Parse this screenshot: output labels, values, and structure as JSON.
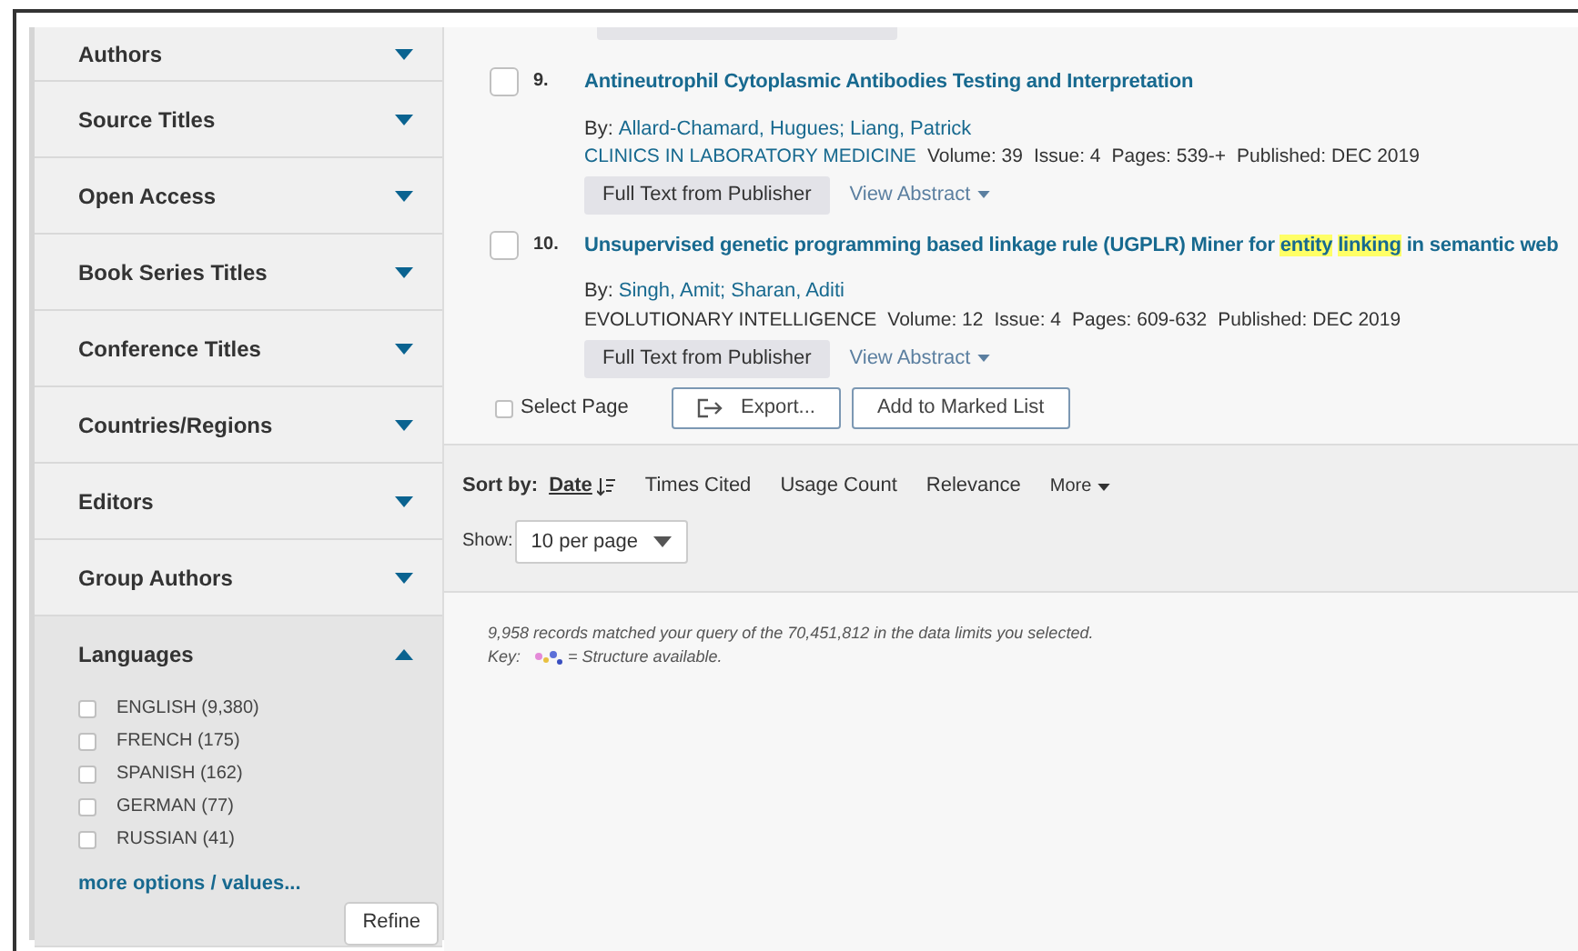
{
  "sidebar": {
    "filters": [
      {
        "label": "Authors",
        "expanded": false
      },
      {
        "label": "Source Titles",
        "expanded": false
      },
      {
        "label": "Open Access",
        "expanded": false
      },
      {
        "label": "Book Series Titles",
        "expanded": false
      },
      {
        "label": "Conference Titles",
        "expanded": false
      },
      {
        "label": "Countries/Regions",
        "expanded": false
      },
      {
        "label": "Editors",
        "expanded": false
      },
      {
        "label": "Group Authors",
        "expanded": false
      },
      {
        "label": "Languages",
        "expanded": true,
        "options": [
          {
            "label": "ENGLISH (9,380)",
            "checked": false
          },
          {
            "label": "FRENCH (175)",
            "checked": false
          },
          {
            "label": "SPANISH (162)",
            "checked": false
          },
          {
            "label": "GERMAN (77)",
            "checked": false
          },
          {
            "label": "RUSSIAN (41)",
            "checked": false
          }
        ],
        "more_link": "more options / values...",
        "refine_button": "Refine"
      }
    ]
  },
  "results": [
    {
      "number": "9.",
      "checked": false,
      "title": [
        {
          "text": "Antineutrophil Cytoplasmic Antibodies Testing and Interpretation",
          "highlighted": false
        }
      ],
      "by_label": "By:",
      "authors": [
        "Allard-Chamard, Hugues;",
        "Liang, Patrick"
      ],
      "source": "CLINICS IN LABORATORY MEDICINE",
      "source_link": true,
      "details": [
        "Volume: 39",
        "Issue: 4",
        "Pages: 539-+",
        "Published: DEC 2019"
      ],
      "full_text_button": "Full Text from Publisher",
      "abstract_link": "View Abstract"
    },
    {
      "number": "10.",
      "checked": false,
      "title": [
        {
          "text": "Unsupervised genetic programming based linkage rule (UGPLR) Miner for",
          "highlighted": false
        },
        {
          "text": "entity",
          "highlighted": true
        },
        {
          "text": "linking",
          "highlighted": true
        },
        {
          "text": "in semantic web",
          "highlighted": false
        }
      ],
      "by_label": "By:",
      "authors": [
        "Singh, Amit;",
        "Sharan, Aditi"
      ],
      "source": "EVOLUTIONARY INTELLIGENCE",
      "source_link": false,
      "details": [
        "Volume: 12",
        "Issue: 4",
        "Pages: 609-632",
        "Published: DEC 2019"
      ],
      "full_text_button": "Full Text from Publisher",
      "abstract_link": "View Abstract"
    }
  ],
  "page_actions": {
    "select_page": {
      "label": "Select Page",
      "checked": false
    },
    "export_button": "Export...",
    "marked_list_button": "Add to Marked List"
  },
  "sort": {
    "label": "Sort by:",
    "options": [
      {
        "label": "Date",
        "selected": true
      },
      {
        "label": "Times Cited",
        "selected": false
      },
      {
        "label": "Usage Count",
        "selected": false
      },
      {
        "label": "Relevance",
        "selected": false
      }
    ],
    "more": "More"
  },
  "show": {
    "label": "Show:",
    "value": "10 per page"
  },
  "summary": {
    "records": "9,958 records matched your query of the 70,451,812 in the data limits you selected.",
    "key_label": "Key:",
    "key_text": "= Structure available."
  }
}
